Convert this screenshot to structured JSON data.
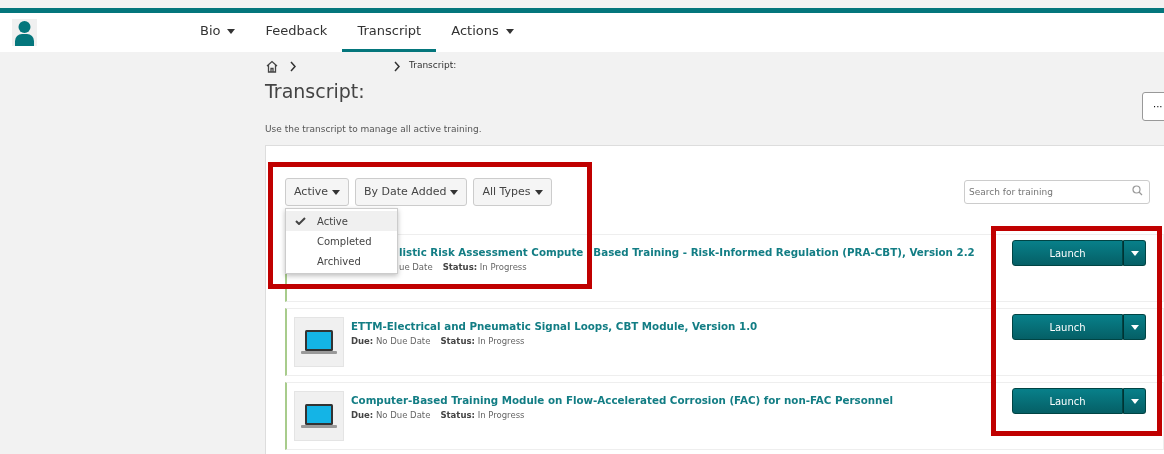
{
  "nav": {
    "tabs": [
      {
        "label": "Bio",
        "dropdown": true,
        "selected": false
      },
      {
        "label": "Feedback",
        "dropdown": false,
        "selected": false
      },
      {
        "label": "Transcript",
        "dropdown": false,
        "selected": true
      },
      {
        "label": "Actions",
        "dropdown": true,
        "selected": false
      }
    ]
  },
  "breadcrumb": {
    "current": "Transcript:"
  },
  "page": {
    "title": "Transcript:",
    "description": "Use the transcript to manage all active training.",
    "more_button": "···"
  },
  "filters": {
    "highlight": true,
    "buttons": [
      "Active",
      "By Date Added",
      "All Types"
    ],
    "menu": [
      {
        "label": "Active",
        "selected": true
      },
      {
        "label": "Completed",
        "selected": false
      },
      {
        "label": "Archived",
        "selected": false
      }
    ]
  },
  "search": {
    "placeholder": "Search for training"
  },
  "launch_highlight": true,
  "trainings": [
    {
      "title_parts": [
        "listic Risk Assessment Compute",
        "Based Training - Risk-Informed Regulation (PRA-CBT), Version 2.2"
      ],
      "covered": true,
      "due": "ue Date",
      "status_label": "Status:",
      "status": "In Progress",
      "action": "Launch"
    },
    {
      "title": "ETTM-Electrical and Pneumatic Signal Loops, CBT Module, Version 1.0",
      "covered": false,
      "due_label": "Due:",
      "due": "No Due Date",
      "status_label": "Status:",
      "status": "In Progress",
      "action": "Launch"
    },
    {
      "title": "Computer-Based Training Module on Flow-Accelerated Corrosion (FAC) for non-FAC Personnel",
      "covered": false,
      "due_label": "Due:",
      "due": "No Due Date",
      "status_label": "Status:",
      "status": "In Progress",
      "action": "Launch"
    }
  ]
}
